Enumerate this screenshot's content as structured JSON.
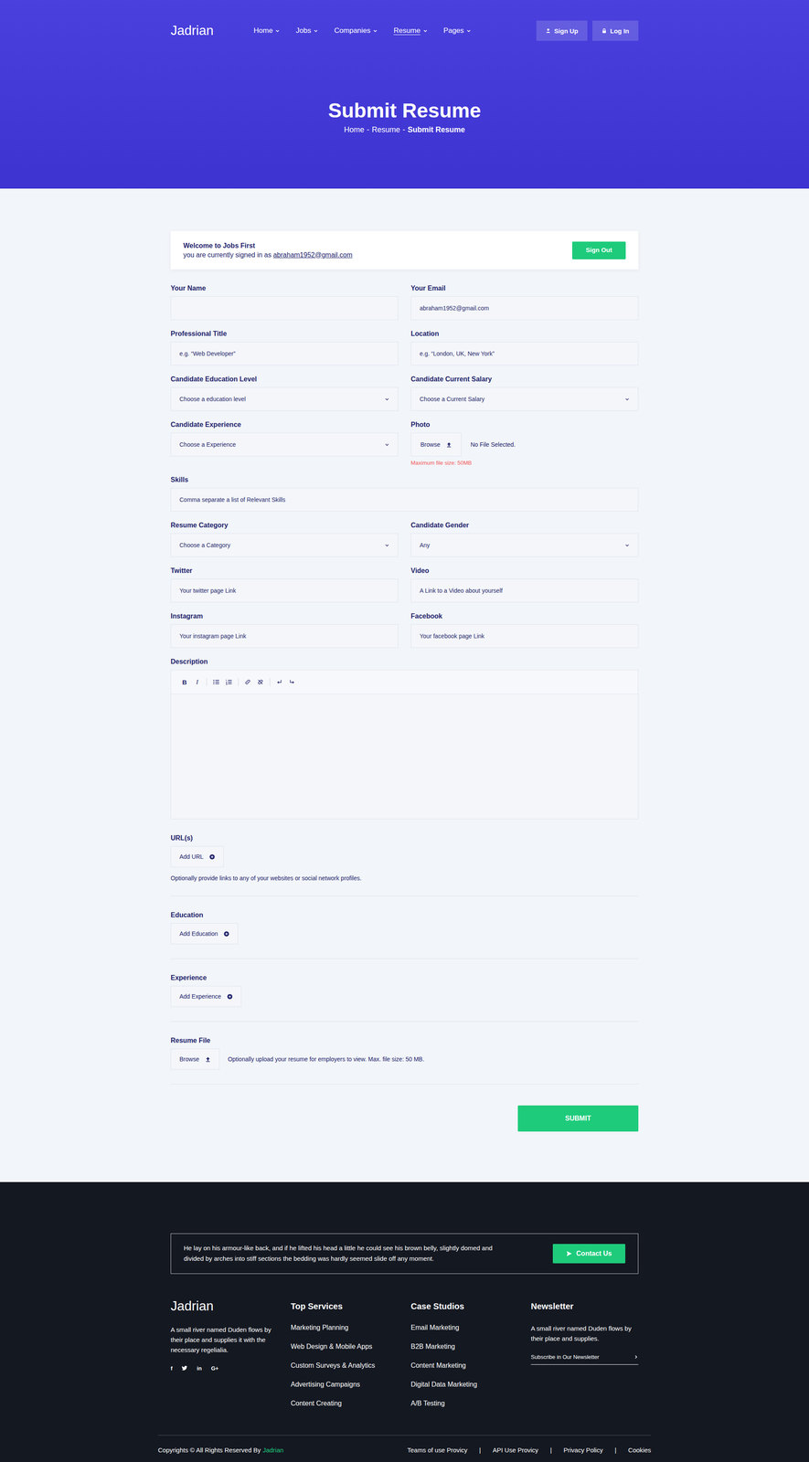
{
  "header": {
    "logo": "Jadrian",
    "nav": [
      {
        "label": "Home",
        "selected": false,
        "dropdown": true
      },
      {
        "label": "Jobs",
        "selected": false,
        "dropdown": true
      },
      {
        "label": "Companies",
        "selected": false,
        "dropdown": true
      },
      {
        "label": "Resume",
        "selected": true,
        "dropdown": true
      },
      {
        "label": "Pages",
        "selected": false,
        "dropdown": true
      }
    ],
    "auth": [
      {
        "kind": "user",
        "label": "Sign Up"
      },
      {
        "kind": "lock",
        "label": "Log In"
      }
    ],
    "title": "Submit Resume",
    "breadcrumb": {
      "separator": "-",
      "items": [
        {
          "label": "Home",
          "current": false
        },
        {
          "label": "Resume",
          "current": false
        },
        {
          "label": "Submit Resume",
          "current": true
        }
      ]
    }
  },
  "welcome": {
    "title": "Welcome to Jobs First",
    "text": "you are currently signed in as",
    "email": "abraham1952@gmail.com",
    "button": "Sign Out"
  },
  "fields": [
    {
      "label": "Your Name",
      "kind": "text",
      "text": "",
      "wide": false
    },
    {
      "label": "Your Email",
      "kind": "text",
      "text": "abraham1952@gmail.com",
      "wide": false
    },
    {
      "label": "Professional Title",
      "kind": "text",
      "text": "e.g. “Web Developer”",
      "wide": false
    },
    {
      "label": "Location",
      "kind": "text",
      "text": "e.g. “London, UK, New York”",
      "wide": false
    },
    {
      "label": "Candidate Education Level",
      "kind": "select",
      "text": "Choose a education level",
      "wide": false
    },
    {
      "label": "Candidate Current Salary",
      "kind": "select",
      "text": "Choose a Current Salary",
      "wide": false
    },
    {
      "label": "Candidate Experience",
      "kind": "select",
      "text": "Choose a Experience",
      "wide": false
    },
    {
      "label": "Photo",
      "kind": "file",
      "text": "No File Selected.",
      "button": "Browse",
      "hint": "Maximum file size: 50MB",
      "wide": false
    },
    {
      "label": "Skills",
      "kind": "text",
      "text": "Comma separate a list of Relevant Skills",
      "wide": true
    },
    {
      "label": "Resume Category",
      "kind": "select",
      "text": "Choose a Category",
      "wide": false
    },
    {
      "label": "Candidate Gender",
      "kind": "select",
      "text": "Any",
      "wide": false
    },
    {
      "label": "Twitter",
      "kind": "text",
      "text": "Your twitter page Link",
      "wide": false
    },
    {
      "label": "Video",
      "kind": "text",
      "text": "A Link to a Video about yourself",
      "wide": false
    },
    {
      "label": "Instagram",
      "kind": "text",
      "text": "Your instagram page Link",
      "wide": false
    },
    {
      "label": "Facebook",
      "kind": "text",
      "text": "Your facebook page Link",
      "wide": false
    }
  ],
  "description": {
    "label": "Description",
    "toolbar": [
      {
        "kind": "bold",
        "glyph": "B",
        "group": 1
      },
      {
        "kind": "italic",
        "glyph": "I",
        "group": 1
      },
      {
        "kind": "bullet-list",
        "glyph": "",
        "group": 2
      },
      {
        "kind": "number-list",
        "glyph": "",
        "group": 2
      },
      {
        "kind": "link",
        "glyph": "",
        "group": 3
      },
      {
        "kind": "unlink",
        "glyph": "",
        "group": 3
      },
      {
        "kind": "undo",
        "glyph": "",
        "group": 4
      },
      {
        "kind": "redo",
        "glyph": "",
        "group": 4
      }
    ]
  },
  "sections": [
    {
      "label": "URL(s)",
      "kind": "add",
      "button": "Add URL",
      "note": "Optionally provide links to any of your websites or social network profiles."
    },
    {
      "label": "Education",
      "kind": "add",
      "button": "Add Education",
      "note": ""
    },
    {
      "label": "Experience",
      "kind": "add",
      "button": "Add Experience",
      "note": ""
    },
    {
      "label": "Resume File",
      "kind": "upload",
      "button": "Browse",
      "note": "Optionally upload your resume for employers to view. Max. file size: 50 MB."
    }
  ],
  "submit": "SUBMIT",
  "footer": {
    "contact": {
      "text": "He lay on his armour-like back, and if he lifted his head a little he could see his brown belly, slightly domed and divided by arches into stiff sections the bedding was hardly seemed slide off any moment.",
      "button": "Contact Us"
    },
    "brand": "Jadrian",
    "about": "A small river named Duden flows by their place and supplies it with the necessary regelialia.",
    "socials": [
      {
        "kind": "text",
        "glyph": "f"
      },
      {
        "kind": "twitter",
        "glyph": ""
      },
      {
        "kind": "text",
        "glyph": "in"
      },
      {
        "kind": "text",
        "glyph": "G+"
      }
    ],
    "columns": [
      {
        "title": "Top Services",
        "items": [
          "Marketing Planning",
          "Web Design & Mobile  Apps",
          "Custom Surveys & Analytics",
          "Advertising Campaigns",
          "Content Creating"
        ]
      },
      {
        "title": "Case Studios",
        "items": [
          "Email Marketing",
          "B2B Marketing",
          "Content Marketing",
          "Digital Data Marketing",
          "A/B Testing"
        ]
      }
    ],
    "newsletter": {
      "title": "Newsletter",
      "text": "A small river named Duden flows by their place and supplies.",
      "field": "Subscribe in Our Newsletter"
    },
    "copyright": {
      "text": "Copyrights © All Rights Reserved By",
      "brand": "Jadrian"
    },
    "links": {
      "separator": "|",
      "items": [
        "Teams of use Provicy",
        "API Use Provicy",
        "Privacy Policy",
        "Cookies"
      ]
    }
  }
}
